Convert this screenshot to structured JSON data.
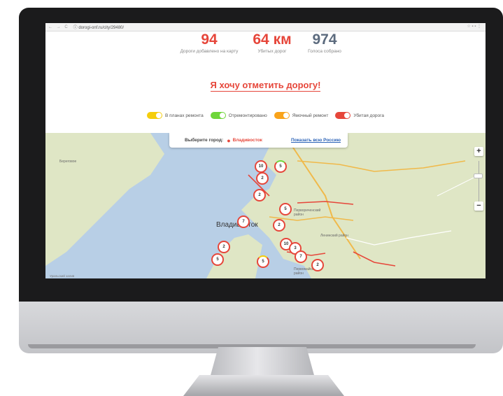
{
  "browser": {
    "nav": "← → C",
    "url": "ⓘ dorogi-onf.ru/city/29480/",
    "tools": "☆  ▪ ▪ ⋮"
  },
  "stats": [
    {
      "value": "94",
      "label": "Дороги добавлено на карту",
      "color": "#e6463a"
    },
    {
      "value": "64 км",
      "label": "Убитых дорог",
      "color": "#e6463a"
    },
    {
      "value": "974",
      "label": "Голоса собрано",
      "color": "#5c6b7e"
    }
  ],
  "cta": "Я хочу отметить дорогу!",
  "legend": [
    {
      "label": "В планах ремонта",
      "color": "#f5cd0b"
    },
    {
      "label": "Отремонтировано",
      "color": "#6fd63a"
    },
    {
      "label": "Ямочный ремонт",
      "color": "#f9a31a"
    },
    {
      "label": "Убитая дорога",
      "color": "#e6463a"
    }
  ],
  "city_select": {
    "label": "Выберите город:",
    "city": "Владивосток",
    "show_all": "Показать всю Россию"
  },
  "map": {
    "city_label": "Владивосток",
    "place_labels": [
      "Береговое",
      "Первореченский район",
      "Ленинский район",
      "Первомайский район"
    ],
    "copyright": "Уральский залив",
    "zoom_in": "+",
    "zoom_out": "−",
    "markers": [
      "10",
      "5",
      "2",
      "2",
      "5",
      "7",
      "2",
      "10",
      "3",
      "7",
      "2",
      "5",
      "2",
      "5"
    ]
  },
  "colors": {
    "accent": "#e6463a",
    "water": "#b8cfe6",
    "land": "#dfe6c5"
  }
}
